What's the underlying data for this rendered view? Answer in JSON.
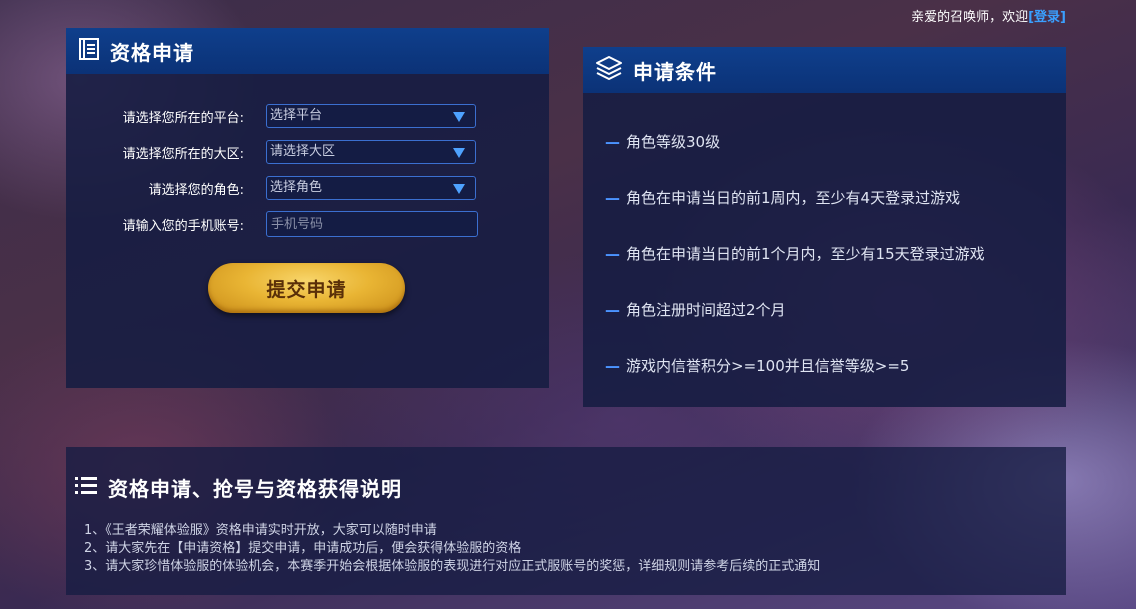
{
  "header": {
    "greeting": "亲爱的召唤师，欢迎",
    "login_link": "[登录]"
  },
  "apply_panel": {
    "title": "资格申请",
    "icon": "document-icon",
    "fields": [
      {
        "label": "请选择您所在的平台:",
        "value": "选择平台",
        "type": "select"
      },
      {
        "label": "请选择您所在的大区:",
        "value": "请选择大区",
        "type": "select"
      },
      {
        "label": "请选择您的角色:",
        "value": "选择角色",
        "type": "select"
      },
      {
        "label": "请输入您的手机账号:",
        "placeholder": "手机号码",
        "type": "input"
      }
    ],
    "submit_label": "提交申请"
  },
  "conditions_panel": {
    "title": "申请条件",
    "icon": "layers-icon",
    "dash": "—",
    "items": [
      "角色等级30级",
      "角色在申请当日的前1周内，至少有4天登录过游戏",
      "角色在申请当日的前1个月内，至少有15天登录过游戏",
      "角色注册时间超过2个月",
      "游戏内信誉积分>=100并且信誉等级>=5"
    ]
  },
  "notes_panel": {
    "title": "资格申请、抢号与资格获得说明",
    "icon": "list-icon",
    "lines": [
      "1、《王者荣耀体验服》资格申请实时开放，大家可以随时申请",
      "2、请大家先在【申请资格】提交申请，申请成功后，便会获得体验服的资格",
      "3、请大家珍惜体验服的体验机会，本赛季开始会根据体验服的表现进行对应正式服账号的奖惩，详细规则请参考后续的正式通知"
    ]
  },
  "colors": {
    "panel_header": "#0f3f8c",
    "accent_blue": "#4b93ff",
    "gold_button": "#e9b534",
    "login_link": "#3aa0ff"
  }
}
